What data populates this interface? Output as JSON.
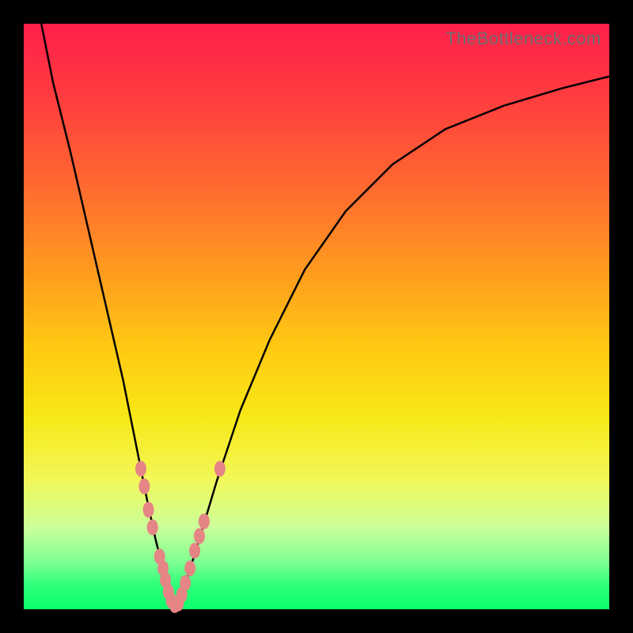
{
  "watermark": "TheBottleneck.com",
  "colors": {
    "frame": "#000000",
    "gradient_top": "#ff1f4b",
    "gradient_bottom": "#0bff6d",
    "curve": "#000000",
    "markers": "#e58585"
  },
  "chart_data": {
    "type": "line",
    "title": "",
    "xlabel": "",
    "ylabel": "",
    "xlim": [
      0,
      100
    ],
    "ylim": [
      0,
      100
    ],
    "series": [
      {
        "name": "bottleneck-curve",
        "x": [
          3,
          5,
          8,
          11,
          14,
          17,
          19,
          21,
          22.5,
          24,
          25,
          25.8,
          26.5,
          27.5,
          30,
          33,
          37,
          42,
          48,
          55,
          63,
          72,
          82,
          92,
          100
        ],
        "y": [
          100,
          90,
          78,
          65,
          52,
          39,
          29,
          19,
          12,
          6,
          2,
          0.5,
          1.5,
          4,
          12,
          22,
          34,
          46,
          58,
          68,
          76,
          82,
          86,
          89,
          91
        ]
      }
    ],
    "markers": [
      {
        "x": 20.0,
        "y": 24
      },
      {
        "x": 20.6,
        "y": 21
      },
      {
        "x": 21.3,
        "y": 17
      },
      {
        "x": 22.0,
        "y": 14
      },
      {
        "x": 23.2,
        "y": 9
      },
      {
        "x": 23.8,
        "y": 7
      },
      {
        "x": 24.2,
        "y": 5
      },
      {
        "x": 24.7,
        "y": 3
      },
      {
        "x": 25.2,
        "y": 1.5
      },
      {
        "x": 25.8,
        "y": 0.7
      },
      {
        "x": 26.4,
        "y": 1
      },
      {
        "x": 27.0,
        "y": 2.5
      },
      {
        "x": 27.6,
        "y": 4.5
      },
      {
        "x": 28.4,
        "y": 7
      },
      {
        "x": 29.2,
        "y": 10
      },
      {
        "x": 30.0,
        "y": 12.5
      },
      {
        "x": 30.8,
        "y": 15
      },
      {
        "x": 33.5,
        "y": 24
      }
    ],
    "legend": false,
    "grid": false
  }
}
